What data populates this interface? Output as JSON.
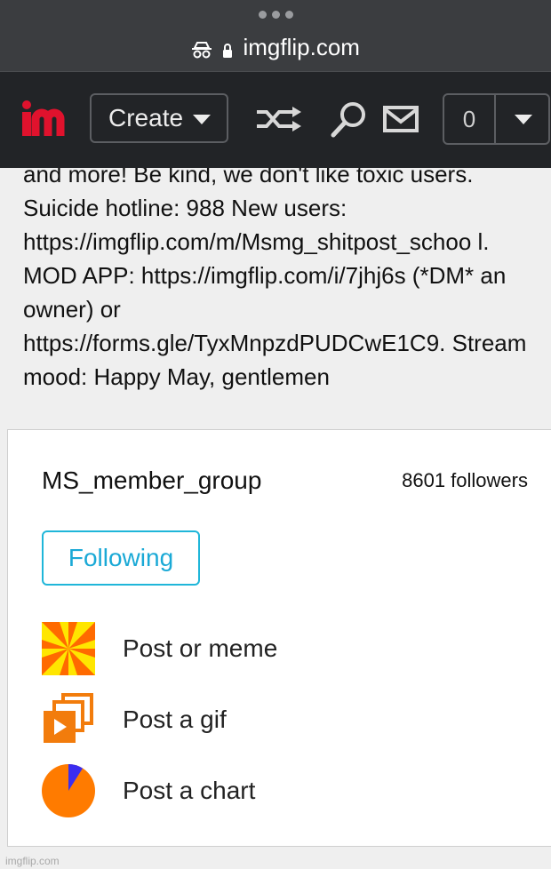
{
  "browser": {
    "url": "imgflip.com"
  },
  "nav": {
    "create_label": "Create",
    "notification_count": "0"
  },
  "description": {
    "text": "and more! Be kind, we don't like toxic users. Suicide hotline: 988 New users: https://imgflip.com/m/Msmg_shitpost_schoo l. MOD APP: https://imgflip.com/i/7jhj6s (*DM* an owner) or https://forms.gle/TyxMnpzdPUDCwE1C9. Stream mood: Happy May, gentlemen"
  },
  "stream": {
    "name": "MS_member_group",
    "followers": "8601 followers",
    "follow_button": "Following"
  },
  "actions": [
    {
      "label": "Post or meme",
      "icon": "meme-pinwheel-icon"
    },
    {
      "label": "Post a gif",
      "icon": "gif-stack-icon"
    },
    {
      "label": "Post a chart",
      "icon": "pie-chart-icon"
    }
  ],
  "watermark": "imgflip.com",
  "colors": {
    "logo_red": "#e0122d",
    "accent_blue": "#1aa9d6",
    "gif_orange": "#f27c0c",
    "pie_orange": "#ff7b00",
    "pie_blue": "#3b2df0",
    "pinwheel_yellow": "#ffe600"
  }
}
